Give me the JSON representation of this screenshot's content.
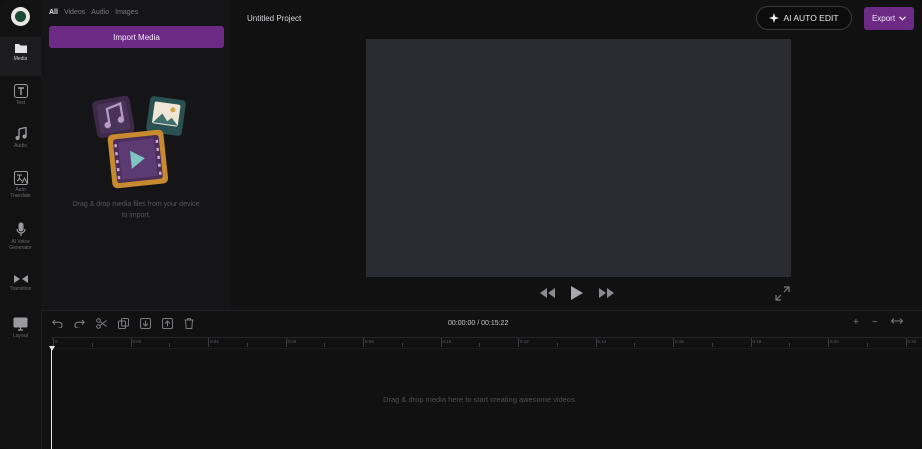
{
  "project": {
    "title": "Untitled Project"
  },
  "sidebar": {
    "items": [
      {
        "label": "Media",
        "icon": "folder-icon"
      },
      {
        "label": "Text",
        "icon": "text-icon"
      },
      {
        "label": "Audio",
        "icon": "music-note-icon"
      },
      {
        "label": "Auto Translate",
        "icon": "translate-icon"
      },
      {
        "label": "AI Voice Generator",
        "icon": "microphone-icon"
      },
      {
        "label": "Transition",
        "icon": "transition-icon"
      },
      {
        "label": "Layout",
        "icon": "monitor-icon"
      }
    ]
  },
  "media_panel": {
    "tabs": [
      "All",
      "Videos",
      "Audio",
      "Images"
    ],
    "active_tab": "All",
    "import_label": "Import Media",
    "hint": "Drag & drop media files from your device to import."
  },
  "header": {
    "ai_button": "AI AUTO EDIT",
    "export_button": "Export"
  },
  "timeline": {
    "timecode": "00:00:00 / 00:15:22",
    "hint": "Drag & drop media here to start creating awesome videos.",
    "ticks": [
      "0",
      "0:02",
      "0:04",
      "0:06",
      "0:08",
      "0:10",
      "0:12",
      "0:14",
      "0:16",
      "0:18",
      "0:20",
      "0:22"
    ]
  },
  "colors": {
    "accent": "#6d2a85",
    "background": "#111112",
    "preview": "#2b2c31"
  }
}
